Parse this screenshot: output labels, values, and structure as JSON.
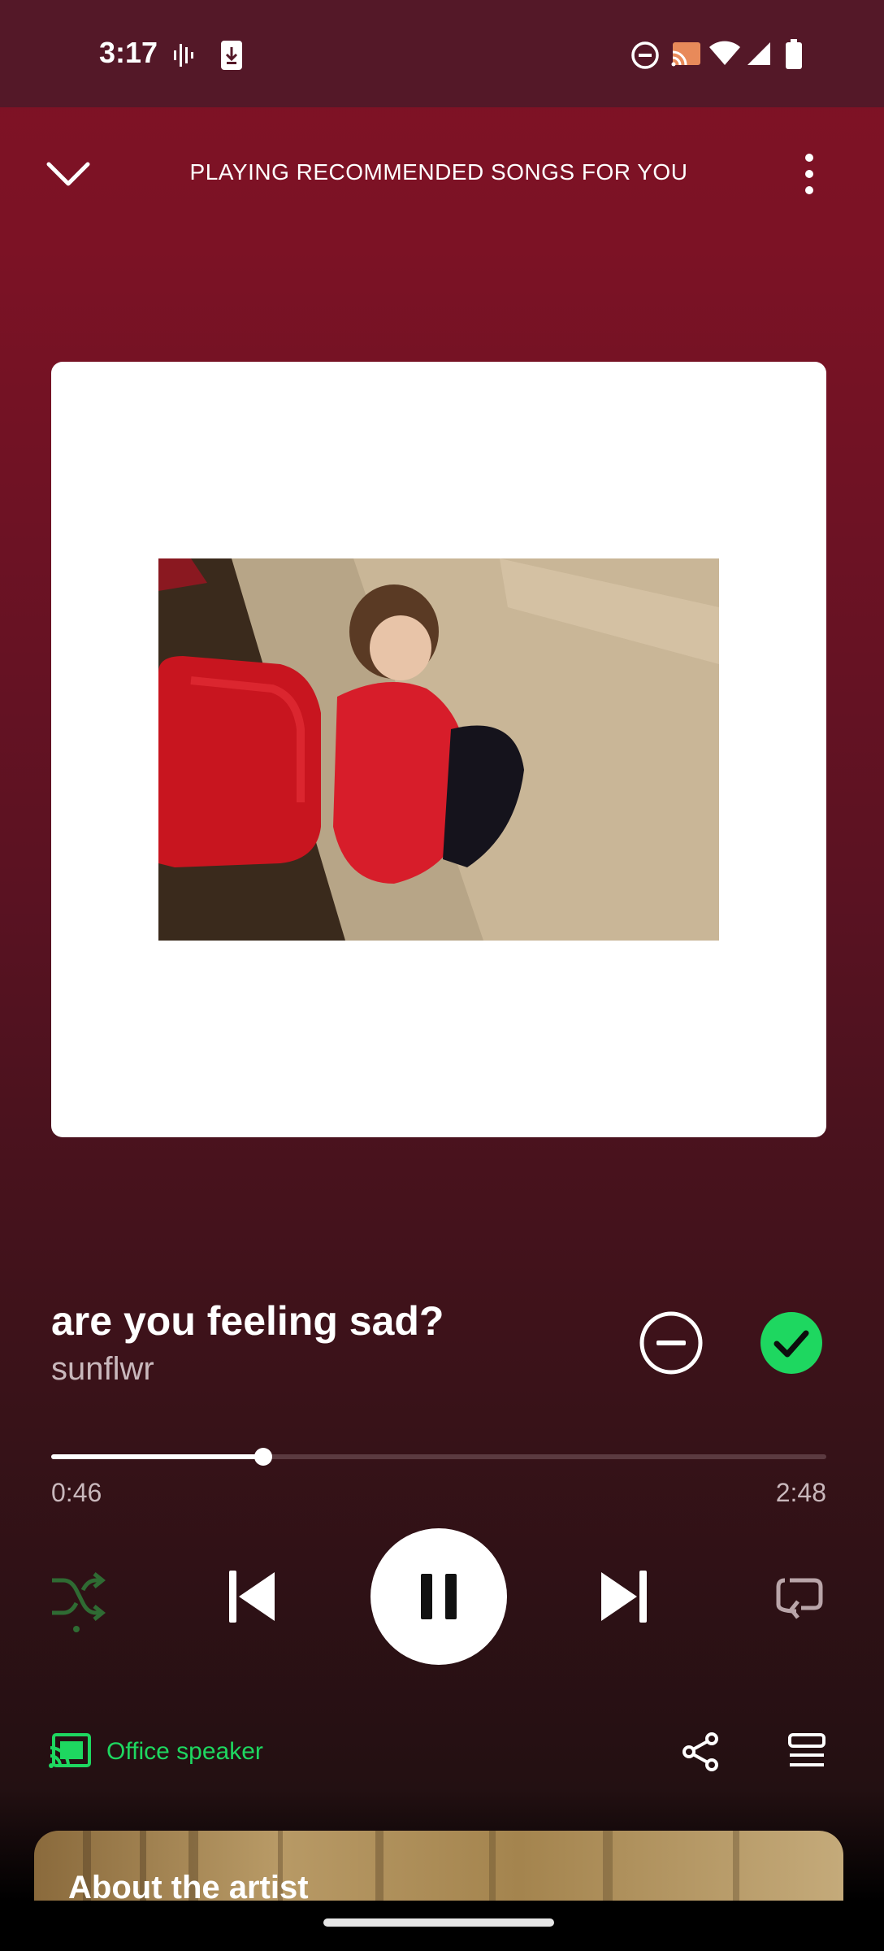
{
  "status_bar": {
    "time": "3:17",
    "icons": [
      "voicemail-icon",
      "download-icon",
      "do-not-disturb-icon",
      "cast-icon",
      "wifi-icon",
      "cellular-icon",
      "battery-icon"
    ]
  },
  "header": {
    "title": "PLAYING RECOMMENDED SONGS FOR YOU",
    "collapse_icon": "chevron-down-icon",
    "menu_icon": "more-vertical-icon"
  },
  "track": {
    "title": "are you feeling sad?",
    "artist": "sunflwr",
    "elapsed": "0:46",
    "duration": "2:48",
    "progress_fraction": 0.274
  },
  "controls": {
    "shuffle_icon": "shuffle-icon",
    "previous_icon": "skip-previous-icon",
    "pause_icon": "pause-icon",
    "next_icon": "skip-next-icon",
    "repeat_icon": "repeat-icon",
    "hide_icon": "minus-circle-icon",
    "liked_icon": "check-circle-icon"
  },
  "device": {
    "label": "Office speaker",
    "icon": "cast-connected-icon"
  },
  "actions": {
    "share_icon": "share-icon",
    "queue_icon": "queue-icon"
  },
  "about": {
    "title": "About the artist"
  },
  "colors": {
    "accent_green": "#1ed760",
    "background_top": "#7f1125",
    "status_bar": "#541828"
  }
}
